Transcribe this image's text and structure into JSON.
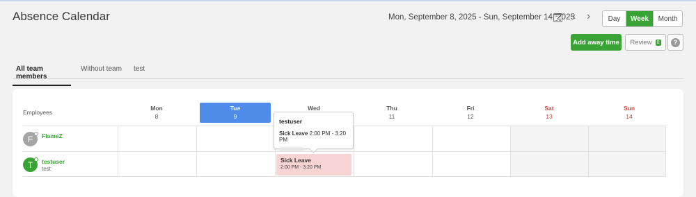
{
  "page": {
    "title": "Absence Calendar"
  },
  "header": {
    "date_range": "Mon, September 8, 2025 - Sun, September 14, 2025",
    "prev_icon": "chevron-left-icon",
    "next_icon": "chevron-right-icon",
    "calendar_icon": "calendar-icon",
    "view_options": [
      "Day",
      "Week",
      "Month"
    ],
    "active_view": "Week"
  },
  "actions": {
    "add_away_label": "Add away time",
    "review_label": "Review",
    "review_count": "0",
    "help_label": "?"
  },
  "tabs": {
    "items": [
      "All team members",
      "Without team",
      "test"
    ],
    "active": "All team members"
  },
  "calendar": {
    "employees_header": "Employees",
    "days": [
      {
        "name": "Mon",
        "num": "8"
      },
      {
        "name": "Tue",
        "num": "9"
      },
      {
        "name": "Wed",
        "num": "10"
      },
      {
        "name": "Thu",
        "num": "11"
      },
      {
        "name": "Fri",
        "num": "12"
      },
      {
        "name": "Sat",
        "num": "13"
      },
      {
        "name": "Sun",
        "num": "14"
      }
    ],
    "today": "Tue",
    "employees": [
      {
        "initial": "F",
        "name": "FlameZ",
        "team": ""
      },
      {
        "initial": "T",
        "name": "testuser",
        "team": "test"
      }
    ],
    "event": {
      "employee": "testuser",
      "day": "Wed",
      "type": "Sick Leave",
      "time": "2:00 PM - 3:20 PM"
    },
    "tooltip": {
      "user": "testuser",
      "type": "Sick Leave",
      "time": "2:00 PM - 3:20 PM"
    }
  },
  "colors": {
    "accent_green": "#3aa335",
    "today_blue": "#4f8be8",
    "weekend_red": "#d0443c",
    "sick_leave_bg": "#f9d4d4"
  }
}
